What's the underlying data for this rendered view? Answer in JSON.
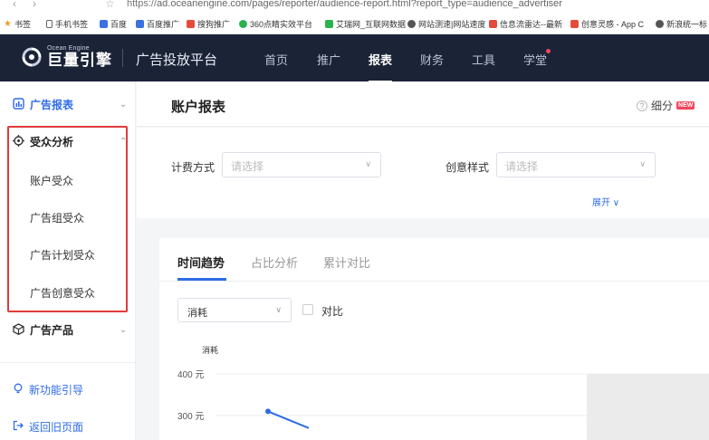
{
  "browser": {
    "url_scheme": "https://",
    "url_rest": "ad.oceanengine.com/pages/reporter/audience-report.html?report_type=audience_advertiser",
    "bookmarks": [
      {
        "label": "书签",
        "color": "#f0a020"
      },
      {
        "label": "手机书签",
        "color": "#666666"
      },
      {
        "label": "百度",
        "color": "#3b72e0"
      },
      {
        "label": "百度推广",
        "color": "#3b72e0"
      },
      {
        "label": "搜狗推广",
        "color": "#e64a3b"
      },
      {
        "label": "360点睛实效平台",
        "color": "#2bb24c"
      },
      {
        "label": "艾瑞网_互联网数据",
        "color": "#2bb24c"
      },
      {
        "label": "网站测速|网站速度",
        "color": "#555555"
      },
      {
        "label": "信息流雷达--最新",
        "color": "#e64a3b"
      },
      {
        "label": "创意灵感 - App C",
        "color": "#e64a3b"
      },
      {
        "label": "新浪统一标",
        "color": "#555555"
      }
    ]
  },
  "topnav": {
    "brand_sub": "Ocean Engine",
    "brand_main": "巨量引擎",
    "platform": "广告投放平台",
    "items": [
      "首页",
      "推广",
      "报表",
      "财务",
      "工具",
      "学堂"
    ],
    "active": "报表",
    "accent": "#1b2337"
  },
  "sidebar": {
    "report": "广告报表",
    "audience": "受众分析",
    "audience_items": [
      "账户受众",
      "广告组受众",
      "广告计划受众",
      "广告创意受众"
    ],
    "product": "广告产品",
    "guide": "新功能引导",
    "back": "返回旧页面",
    "accent": "#2f6be6",
    "highlight": "#e03b3b"
  },
  "page": {
    "title": "账户报表",
    "detail": "细分",
    "new_badge": "NEW"
  },
  "filters": {
    "billing_label": "计费方式",
    "billing_placeholder": "请选择",
    "creative_label": "创意样式",
    "creative_placeholder": "请选择",
    "expand": "展开 ∨"
  },
  "chart_panel": {
    "tabs": [
      "时间趋势",
      "占比分析",
      "累计对比"
    ],
    "metric": "消耗",
    "compare": "对比"
  },
  "chart_data": {
    "type": "line",
    "ylabel": "消耗",
    "y_ticks": [
      "400 元",
      "300 元"
    ],
    "series": [
      {
        "values": [
          310,
          270
        ]
      }
    ]
  }
}
